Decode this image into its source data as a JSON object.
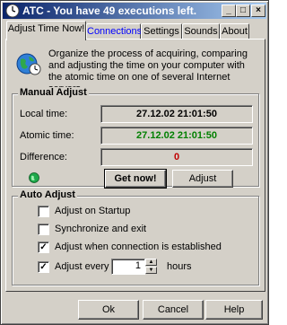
{
  "window": {
    "title": "ATC - You have 49 executions left.",
    "controls": {
      "minimize": "_",
      "maximize": "□",
      "close": "×"
    }
  },
  "tabs": [
    {
      "label": "Adjust Time Now!",
      "active": true
    },
    {
      "label": "Connections",
      "active": false
    },
    {
      "label": "Settings",
      "active": false
    },
    {
      "label": "Sounds",
      "active": false
    },
    {
      "label": "About",
      "active": false
    }
  ],
  "intro": {
    "icon": "globe-clock-icon",
    "text": "Organize the process of acquiring, comparing and adjusting the time on your computer with the atomic time on one of several Internet servers."
  },
  "manual_adjust": {
    "title": "Manual Adjust",
    "local_time_label": "Local time:",
    "local_time_value": "27.12.02 21:01:50",
    "atomic_time_label": "Atomic time:",
    "atomic_time_value": "27.12.02 21:01:50",
    "difference_label": "Difference:",
    "difference_value": "0",
    "status_icon": "status-globe-icon",
    "get_now_button": "Get now!",
    "adjust_button": "Adjust"
  },
  "auto_adjust": {
    "title": "Auto Adjust",
    "options": [
      {
        "label": "Adjust on Startup",
        "checked": false
      },
      {
        "label": "Synchronize and exit",
        "checked": false
      },
      {
        "label": "Adjust when connection is established",
        "checked": true
      },
      {
        "label": "Adjust every",
        "checked": true
      }
    ],
    "interval_value": "1",
    "interval_unit": "hours"
  },
  "footer": {
    "ok_button": "Ok",
    "cancel_button": "Cancel",
    "help_button": "Help"
  },
  "colors": {
    "title_gradient_start": "#0a246a",
    "title_gradient_end": "#a6caf0",
    "atomic_time": "#008000",
    "difference": "#c00000",
    "link_tab": "#0000ff"
  }
}
